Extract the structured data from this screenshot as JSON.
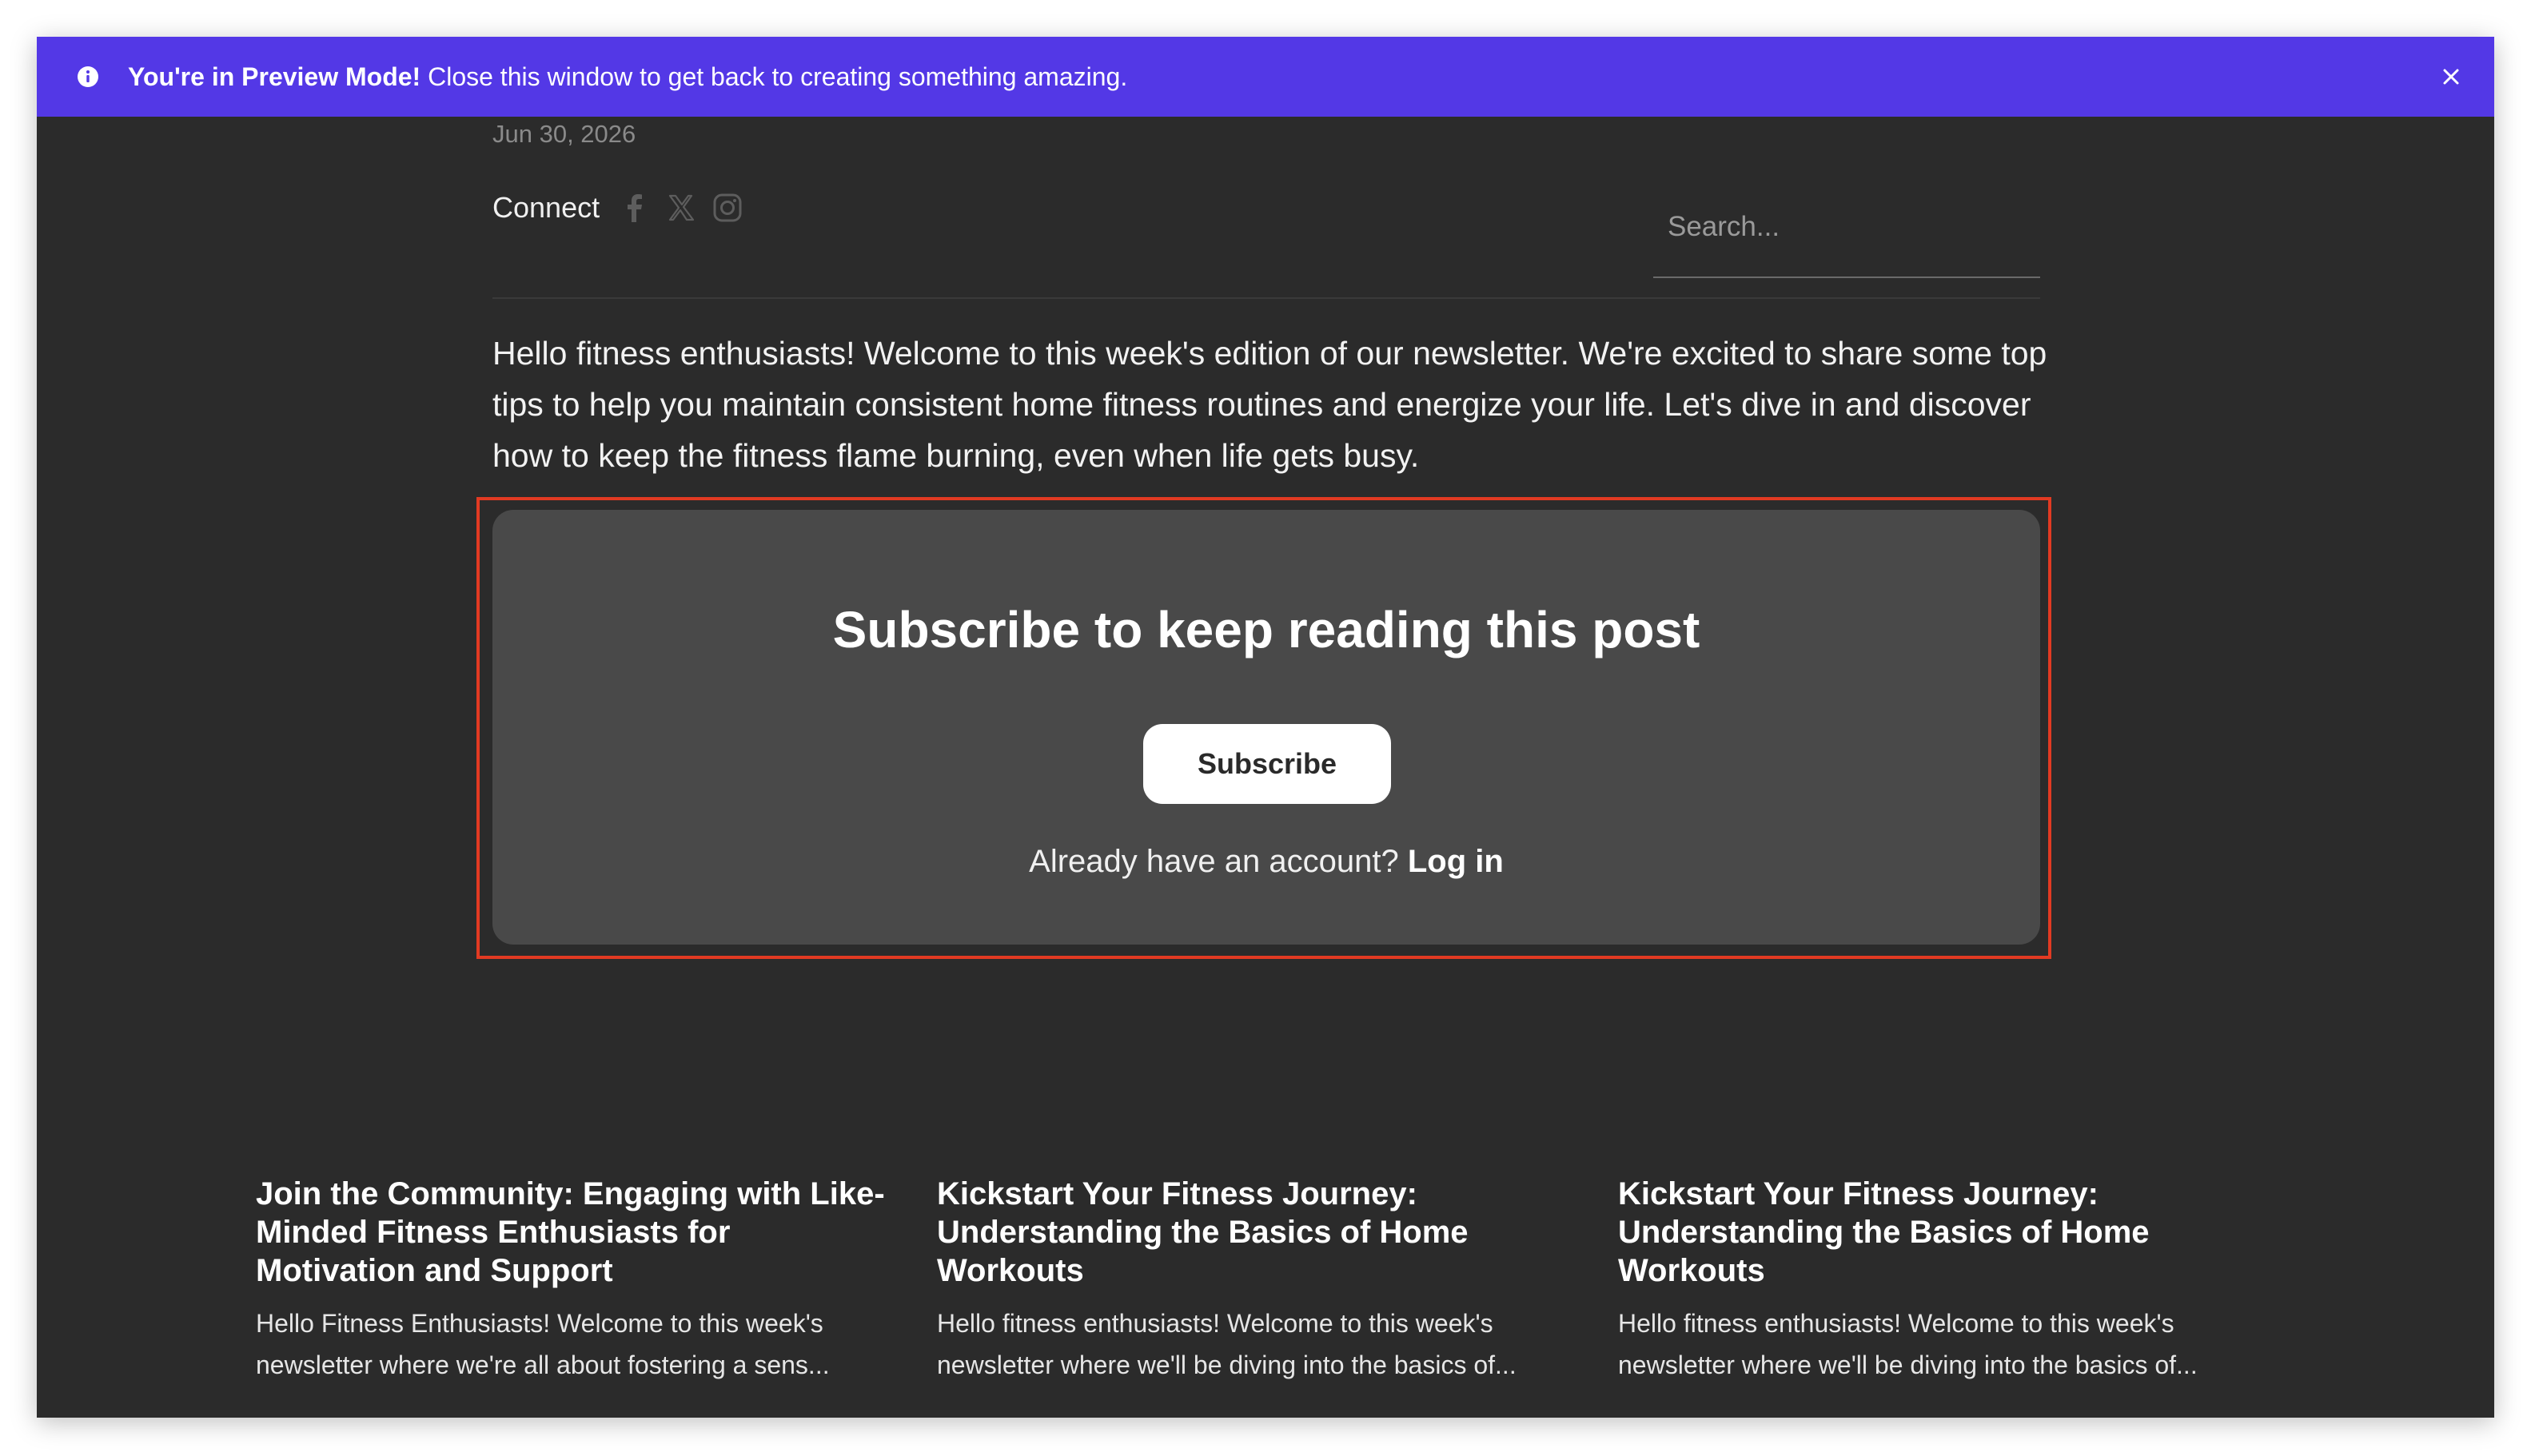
{
  "preview_bar": {
    "bold_text": "You're in Preview Mode!",
    "text": " Close this window to get back to creating something amazing.",
    "icon": "info-icon",
    "close_icon": "close-icon",
    "color": "#5338e6"
  },
  "post": {
    "date": "Jun 30, 2026",
    "connect_label": "Connect",
    "social_icons": [
      "facebook-icon",
      "x-icon",
      "instagram-icon"
    ],
    "search_placeholder": "Search...",
    "intro": "Hello fitness enthusiasts! Welcome to this week's edition of our newsletter. We're excited to share some top tips to help you maintain consistent home fitness routines and energize your life. Let's dive in and discover how to keep the fitness flame burning, even when life gets busy."
  },
  "paywall": {
    "title": "Subscribe to keep reading this post",
    "subscribe_label": "Subscribe",
    "account_text": "Already have an account?",
    "login_label": "Log in",
    "highlight_color": "#e23a22"
  },
  "related_posts": [
    {
      "title": "Join the Community: Engaging with Like-Minded Fitness Enthusiasts for Motivation and Support",
      "excerpt": "Hello Fitness Enthusiasts! Welcome to this week's newsletter where we're all about fostering a sens..."
    },
    {
      "title": "Kickstart Your Fitness Journey: Understanding the Basics of Home Workouts",
      "excerpt": "Hello fitness enthusiasts! Welcome to this week's newsletter where we'll be diving into the basics of..."
    },
    {
      "title": "Kickstart Your Fitness Journey: Understanding the Basics of Home Workouts",
      "excerpt": "Hello fitness enthusiasts! Welcome to this week's newsletter where we'll be diving into the basics of..."
    }
  ]
}
